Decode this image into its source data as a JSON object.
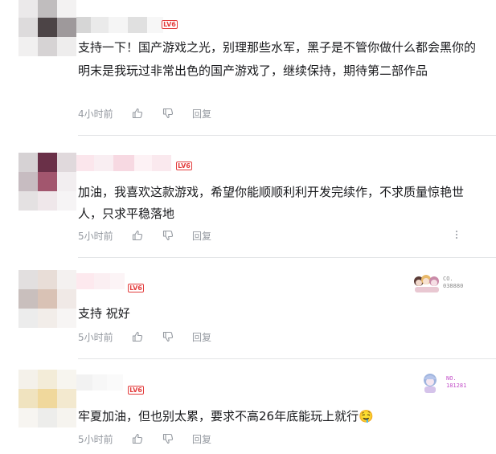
{
  "comments": [
    {
      "level": "LV6",
      "text_lines": [
        "支持一下！国产游戏之光，别理那些水军，黑子是不管你做什么都会黑你的",
        "明末是我玩过非常出色的国产游戏了，继续保持，期待第二部作品"
      ],
      "time": "4小时前",
      "reply_label": "回复",
      "avatar_colors": [
        "#ebe9ea",
        "#c0bdbe",
        "#f3f2f2",
        "#dddbdc",
        "#4c4446",
        "#9e999b",
        "#f1f0f0",
        "#d6d3d4",
        "#eeeded"
      ],
      "name_colors": [
        "#d6d6d6",
        "#eaeaea",
        "#f5f5f5",
        "#e0e0e0",
        "#f7f7f7"
      ]
    },
    {
      "level": "LV6",
      "text": "加油，我喜欢这款游戏，希望你能顺顺利利开发完续作，不求质量惊艳世人，只求平稳落地",
      "time": "5小时前",
      "reply_label": "回复",
      "avatar_colors": [
        "#d6d2d4",
        "#6a3048",
        "#e0d9dc",
        "#c7bcc1",
        "#a2566e",
        "#f2eef0",
        "#e4e1e2",
        "#efe7ea",
        "#f6f4f5"
      ],
      "name_colors": [
        "#fbe6ec",
        "#f9eef2",
        "#f7d9e2",
        "#fdf2f5",
        "#fae9ee"
      ]
    },
    {
      "level": "LV6",
      "text": "支持 祝好",
      "time": "5小时前",
      "reply_label": "回复",
      "avatar_colors": [
        "#e2dfdf",
        "#e8ddd7",
        "#f4f1f0",
        "#c9bfbd",
        "#d9c2b5",
        "#f0e9e6",
        "#ececec",
        "#f2ede9",
        "#f7f5f4"
      ],
      "name_colors": [
        "#fde9ee",
        "#fbeff2",
        "#fcf4f6"
      ],
      "badge": {
        "line1": "CO.",
        "line2": "038880",
        "color": "#8a8a8a"
      }
    },
    {
      "level": "LV6",
      "text": "牢夏加油，但也别太累，要求不高26年底能玩上就行",
      "emoji": "🤤",
      "time": "5小时前",
      "reply_label": "回复",
      "avatar_colors": [
        "#f4f1ea",
        "#f3ecd8",
        "#f7f5ef",
        "#f0e3bf",
        "#f0d89c",
        "#f3e9cf",
        "#f7f5f1",
        "#ededeb",
        "#f6f4ef"
      ],
      "name_colors": [
        "#f2f2f2",
        "#f7f7f7",
        "#fafafa"
      ],
      "badge": {
        "line1": "NO.",
        "line2": "181281",
        "color": "#c24cc8"
      }
    }
  ]
}
